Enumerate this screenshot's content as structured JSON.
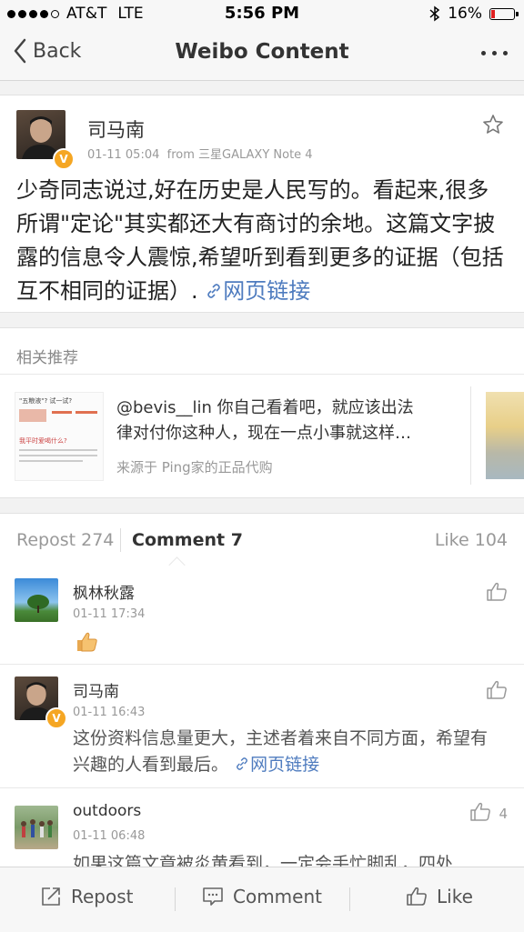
{
  "status_bar": {
    "carrier": "AT&T",
    "network": "LTE",
    "time": "5:56 PM",
    "battery": "16%",
    "battery_level": 0.16
  },
  "nav": {
    "back_label": "Back",
    "title": "Weibo Content"
  },
  "post": {
    "author": "司马南",
    "timestamp": "01-11 05:04",
    "source": "from 三星GALAXY Note 4",
    "text": "少奇同志说过,好在历史是人民写的。看起来,很多所谓\"定论\"其实都还大有商讨的余地。这篇文字披露的信息令人震惊,希望听到看到更多的证据（包括互不相同的证据）.",
    "link_label": "网页链接"
  },
  "related": {
    "header": "相关推荐",
    "item": {
      "line1": "@bevis__lin 你自己看着吧，就应该出法",
      "line2": "律对付你这种人，现在一点小事就这样…",
      "source": "来源于 Ping家的正品代购",
      "thumb_title": "\"五粮液\"? 试一试?",
      "thumb_sub": "我平时爱喝什么?"
    }
  },
  "tabs": {
    "repost": "Repost 274",
    "comment": "Comment 7",
    "like": "Like 104"
  },
  "comments": [
    {
      "name": "枫林秋露",
      "time": "01-11 17:34",
      "text": ""
    },
    {
      "name": "司马南",
      "time": "01-11 16:43",
      "text": "这份资料信息量更大，主述者着来自不同方面，希望有兴趣的人看到最后。",
      "link_label": "网页链接"
    },
    {
      "name": "outdoors",
      "time": "01-11 06:48",
      "text": "如果这篇文章被炎黄看到，一定会手忙脚乱，四处",
      "likes": "4"
    }
  ],
  "bottom_bar": {
    "repost": "Repost",
    "comment": "Comment",
    "like": "Like"
  }
}
